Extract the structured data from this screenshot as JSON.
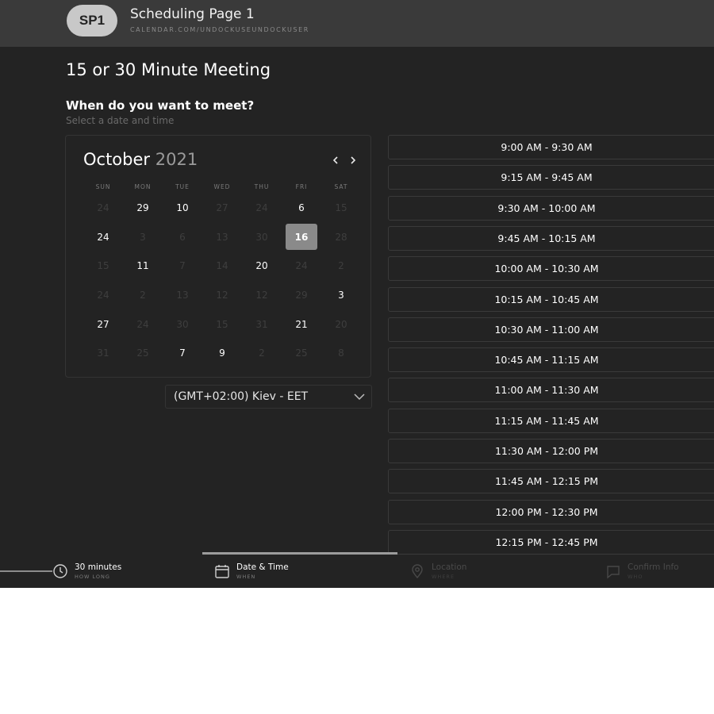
{
  "header": {
    "avatar_initials": "SP1",
    "page_name": "Scheduling Page 1",
    "page_url": "CALENDAR.COM/UNDOCKUSEUNDOCKUSER"
  },
  "meeting": {
    "title": "15 or 30 Minute Meeting",
    "question": "When do you want to meet?",
    "subtitle": "Select a date and time"
  },
  "calendar": {
    "month": "October",
    "year": "2021",
    "prev_icon": "chevron-left-icon",
    "next_icon": "chevron-right-icon",
    "weekdays": [
      "SUN",
      "MON",
      "TUE",
      "WED",
      "THU",
      "FRI",
      "SAT"
    ],
    "selected_day": "16",
    "weeks": [
      [
        {
          "d": "24",
          "a": false
        },
        {
          "d": "29",
          "a": true
        },
        {
          "d": "10",
          "a": true
        },
        {
          "d": "27",
          "a": false
        },
        {
          "d": "24",
          "a": false
        },
        {
          "d": "6",
          "a": true
        },
        {
          "d": "15",
          "a": false
        }
      ],
      [
        {
          "d": "24",
          "a": true
        },
        {
          "d": "3",
          "a": false
        },
        {
          "d": "6",
          "a": false
        },
        {
          "d": "13",
          "a": false
        },
        {
          "d": "30",
          "a": false
        },
        {
          "d": "16",
          "a": true,
          "s": true
        },
        {
          "d": "28",
          "a": false
        }
      ],
      [
        {
          "d": "15",
          "a": false
        },
        {
          "d": "11",
          "a": true
        },
        {
          "d": "7",
          "a": false
        },
        {
          "d": "14",
          "a": false
        },
        {
          "d": "20",
          "a": true
        },
        {
          "d": "24",
          "a": false
        },
        {
          "d": "2",
          "a": false
        }
      ],
      [
        {
          "d": "24",
          "a": false
        },
        {
          "d": "2",
          "a": false
        },
        {
          "d": "13",
          "a": false
        },
        {
          "d": "12",
          "a": false
        },
        {
          "d": "12",
          "a": false
        },
        {
          "d": "29",
          "a": false
        },
        {
          "d": "3",
          "a": true
        }
      ],
      [
        {
          "d": "27",
          "a": true
        },
        {
          "d": "24",
          "a": false
        },
        {
          "d": "30",
          "a": false
        },
        {
          "d": "15",
          "a": false
        },
        {
          "d": "31",
          "a": false
        },
        {
          "d": "21",
          "a": true
        },
        {
          "d": "20",
          "a": false
        }
      ],
      [
        {
          "d": "31",
          "a": false
        },
        {
          "d": "25",
          "a": false
        },
        {
          "d": "7",
          "a": true
        },
        {
          "d": "9",
          "a": true
        },
        {
          "d": "2",
          "a": false
        },
        {
          "d": "25",
          "a": false
        },
        {
          "d": "8",
          "a": false
        }
      ]
    ]
  },
  "timezone": {
    "value": "(GMT+02:00) Kiev - EET",
    "icon": "chevron-down-icon"
  },
  "slots": [
    "9:00 AM - 9:30 AM",
    "9:15 AM - 9:45 AM",
    "9:30 AM - 10:00 AM",
    "9:45 AM - 10:15 AM",
    "10:00 AM - 10:30 AM",
    "10:15 AM - 10:45 AM",
    "10:30 AM - 11:00 AM",
    "10:45 AM - 11:15 AM",
    "11:00 AM - 11:30 AM",
    "11:15 AM - 11:45 AM",
    "11:30 AM - 12:00 PM",
    "11:45 AM - 12:15 PM",
    "12:00 PM - 12:30 PM",
    "12:15 PM - 12:45 PM"
  ],
  "steps": [
    {
      "label": "30 minutes",
      "sub": "HOW LONG",
      "icon": "clock-icon",
      "active": true
    },
    {
      "label": "Date & Time",
      "sub": "WHEN",
      "icon": "calendar-icon",
      "active": true
    },
    {
      "label": "Location",
      "sub": "WHERE",
      "icon": "location-pin-icon",
      "active": false
    },
    {
      "label": "Confirm Info",
      "sub": "WHO",
      "icon": "chat-icon",
      "active": false
    }
  ],
  "colors": {
    "background": "#232323",
    "header": "#3a3a3a",
    "selected_day": "#8a8a8a",
    "border": "#3a3a3a"
  }
}
